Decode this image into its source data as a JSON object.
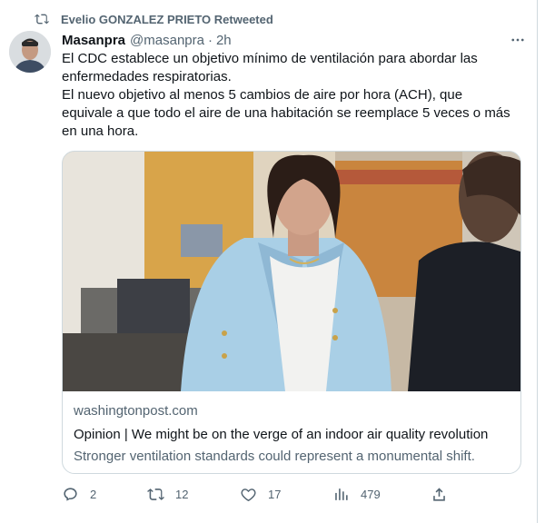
{
  "retweet": {
    "text": "Evelio GONZALEZ PRIETO Retweeted"
  },
  "tweet": {
    "name": "Masanpra",
    "handle": "@masanpra",
    "separator": "·",
    "time": "2h",
    "text": "El CDC establece un objetivo mínimo de ventilación para abordar las enfermedades respiratorias.\nEl nuevo objetivo al menos 5 cambios de aire por hora (ACH), que equivale a que todo el aire de una habitación se reemplace 5 veces o más en una hora."
  },
  "card": {
    "domain": "washingtonpost.com",
    "title": "Opinion | We might be on the verge of an indoor air quality revolution",
    "description": "Stronger ventilation standards could represent a monumental shift."
  },
  "actions": {
    "replies": "2",
    "retweets": "12",
    "likes": "17",
    "views": "479"
  },
  "colors": {
    "text_primary": "#0f1419",
    "text_secondary": "#536471",
    "border": "#cfd9de"
  },
  "icons": [
    "retweet-icon",
    "more-icon",
    "reply-icon",
    "views-icon",
    "share-icon",
    "like-icon"
  ]
}
